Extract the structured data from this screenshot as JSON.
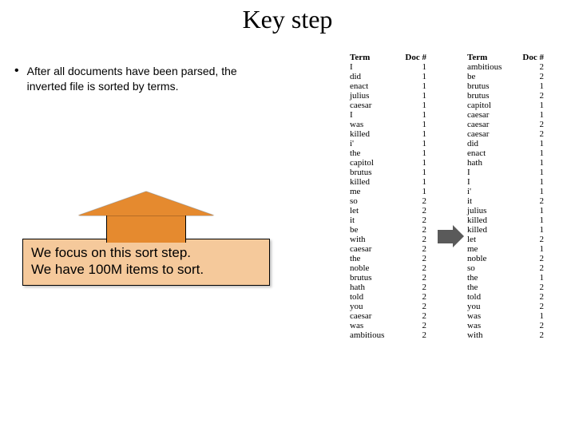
{
  "title": "Key step",
  "bullet": "After all documents have been parsed, the inverted file is sorted by terms.",
  "focus": {
    "line1": "We focus on this sort step.",
    "line2": "We have 100M items to sort."
  },
  "table_headers": {
    "term": "Term",
    "doc": "Doc #"
  },
  "table1": [
    {
      "term": "I",
      "doc": 1
    },
    {
      "term": "did",
      "doc": 1
    },
    {
      "term": "enact",
      "doc": 1
    },
    {
      "term": "julius",
      "doc": 1
    },
    {
      "term": "caesar",
      "doc": 1
    },
    {
      "term": "I",
      "doc": 1
    },
    {
      "term": "was",
      "doc": 1
    },
    {
      "term": "killed",
      "doc": 1
    },
    {
      "term": "i'",
      "doc": 1
    },
    {
      "term": "the",
      "doc": 1
    },
    {
      "term": "capitol",
      "doc": 1
    },
    {
      "term": "brutus",
      "doc": 1
    },
    {
      "term": "killed",
      "doc": 1
    },
    {
      "term": "me",
      "doc": 1
    },
    {
      "term": "so",
      "doc": 2
    },
    {
      "term": "let",
      "doc": 2
    },
    {
      "term": "it",
      "doc": 2
    },
    {
      "term": "be",
      "doc": 2
    },
    {
      "term": "with",
      "doc": 2
    },
    {
      "term": "caesar",
      "doc": 2
    },
    {
      "term": "the",
      "doc": 2
    },
    {
      "term": "noble",
      "doc": 2
    },
    {
      "term": "brutus",
      "doc": 2
    },
    {
      "term": "hath",
      "doc": 2
    },
    {
      "term": "told",
      "doc": 2
    },
    {
      "term": "you",
      "doc": 2
    },
    {
      "term": "caesar",
      "doc": 2
    },
    {
      "term": "was",
      "doc": 2
    },
    {
      "term": "ambitious",
      "doc": 2
    }
  ],
  "table2": [
    {
      "term": "ambitious",
      "doc": 2
    },
    {
      "term": "be",
      "doc": 2
    },
    {
      "term": "brutus",
      "doc": 1
    },
    {
      "term": "brutus",
      "doc": 2
    },
    {
      "term": "capitol",
      "doc": 1
    },
    {
      "term": "caesar",
      "doc": 1
    },
    {
      "term": "caesar",
      "doc": 2
    },
    {
      "term": "caesar",
      "doc": 2
    },
    {
      "term": "did",
      "doc": 1
    },
    {
      "term": "enact",
      "doc": 1
    },
    {
      "term": "hath",
      "doc": 1
    },
    {
      "term": "I",
      "doc": 1
    },
    {
      "term": "I",
      "doc": 1
    },
    {
      "term": "i'",
      "doc": 1
    },
    {
      "term": "it",
      "doc": 2
    },
    {
      "term": "julius",
      "doc": 1
    },
    {
      "term": "killed",
      "doc": 1
    },
    {
      "term": "killed",
      "doc": 1
    },
    {
      "term": "let",
      "doc": 2
    },
    {
      "term": "me",
      "doc": 1
    },
    {
      "term": "noble",
      "doc": 2
    },
    {
      "term": "so",
      "doc": 2
    },
    {
      "term": "the",
      "doc": 1
    },
    {
      "term": "the",
      "doc": 2
    },
    {
      "term": "told",
      "doc": 2
    },
    {
      "term": "you",
      "doc": 2
    },
    {
      "term": "was",
      "doc": 1
    },
    {
      "term": "was",
      "doc": 2
    },
    {
      "term": "with",
      "doc": 2
    }
  ]
}
